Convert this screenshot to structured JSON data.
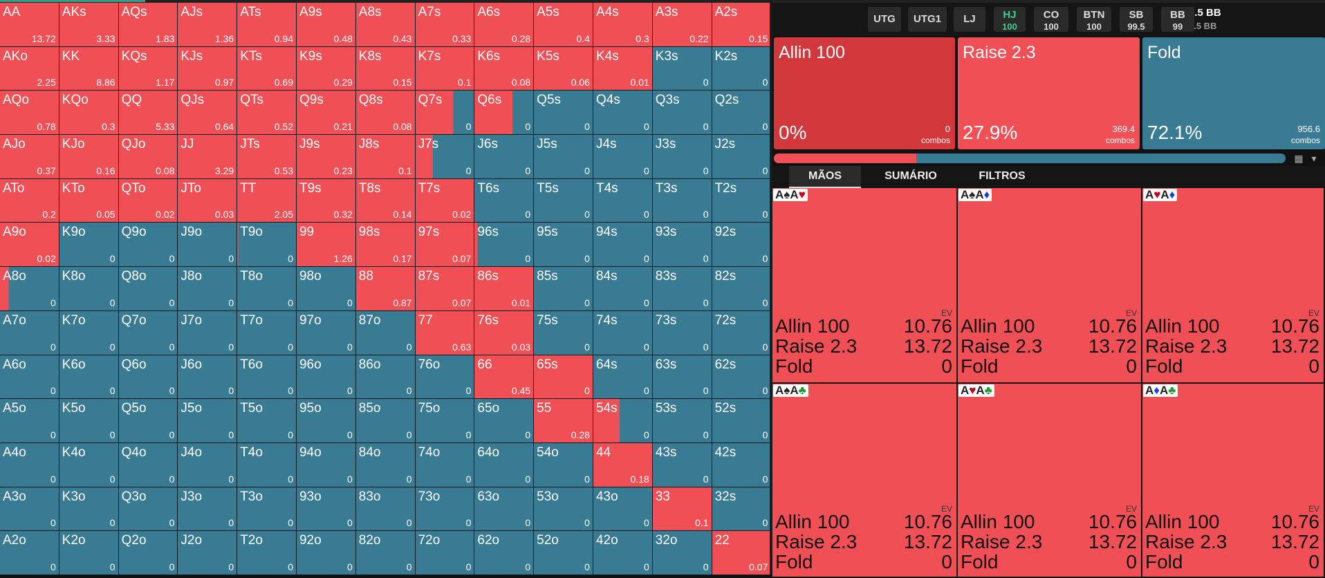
{
  "colors": {
    "raise": "#f05055",
    "fold": "#3a7b94",
    "allin": "#d2373c",
    "accent": "#3ecf8e"
  },
  "grid": [
    [
      [
        "AA",
        "13.72",
        1
      ],
      [
        "AKs",
        "3.33",
        1
      ],
      [
        "AQs",
        "1.83",
        1
      ],
      [
        "AJs",
        "1.36",
        1
      ],
      [
        "ATs",
        "0.94",
        1
      ],
      [
        "A9s",
        "0.48",
        1
      ],
      [
        "A8s",
        "0.43",
        1
      ],
      [
        "A7s",
        "0.33",
        1
      ],
      [
        "A6s",
        "0.28",
        1
      ],
      [
        "A5s",
        "0.4",
        1
      ],
      [
        "A4s",
        "0.3",
        1
      ],
      [
        "A3s",
        "0.22",
        1
      ],
      [
        "A2s",
        "0.15",
        1
      ]
    ],
    [
      [
        "AKo",
        "2.25",
        1
      ],
      [
        "KK",
        "8.86",
        1
      ],
      [
        "KQs",
        "1.17",
        1
      ],
      [
        "KJs",
        "0.97",
        1
      ],
      [
        "KTs",
        "0.69",
        1
      ],
      [
        "K9s",
        "0.29",
        1
      ],
      [
        "K8s",
        "0.15",
        1
      ],
      [
        "K7s",
        "0.1",
        1
      ],
      [
        "K6s",
        "0.08",
        1
      ],
      [
        "K5s",
        "0.06",
        1
      ],
      [
        "K4s",
        "0.01",
        1
      ],
      [
        "K3s",
        "0",
        0
      ],
      [
        "K2s",
        "0",
        0
      ]
    ],
    [
      [
        "AQo",
        "0.78",
        1
      ],
      [
        "KQo",
        "0.3",
        1
      ],
      [
        "QQ",
        "5.33",
        1
      ],
      [
        "QJs",
        "0.64",
        1
      ],
      [
        "QTs",
        "0.52",
        1
      ],
      [
        "Q9s",
        "0.21",
        1
      ],
      [
        "Q8s",
        "0.08",
        1
      ],
      [
        "Q7s",
        "0",
        0.65
      ],
      [
        "Q6s",
        "0",
        0.65
      ],
      [
        "Q5s",
        "0",
        0
      ],
      [
        "Q4s",
        "0",
        0
      ],
      [
        "Q3s",
        "0",
        0
      ],
      [
        "Q2s",
        "0",
        0
      ]
    ],
    [
      [
        "AJo",
        "0.37",
        1
      ],
      [
        "KJo",
        "0.16",
        1
      ],
      [
        "QJo",
        "0.08",
        1
      ],
      [
        "JJ",
        "3.29",
        1
      ],
      [
        "JTs",
        "0.53",
        1
      ],
      [
        "J9s",
        "0.23",
        1
      ],
      [
        "J8s",
        "0.1",
        1
      ],
      [
        "J7s",
        "0",
        0.3
      ],
      [
        "J6s",
        "0",
        0
      ],
      [
        "J5s",
        "0",
        0
      ],
      [
        "J4s",
        "0",
        0
      ],
      [
        "J3s",
        "0",
        0
      ],
      [
        "J2s",
        "0",
        0
      ]
    ],
    [
      [
        "ATo",
        "0.2",
        1
      ],
      [
        "KTo",
        "0.05",
        1
      ],
      [
        "QTo",
        "0.02",
        1
      ],
      [
        "JTo",
        "0.03",
        1
      ],
      [
        "TT",
        "2.05",
        1
      ],
      [
        "T9s",
        "0.32",
        1
      ],
      [
        "T8s",
        "0.14",
        1
      ],
      [
        "T7s",
        "0.02",
        1
      ],
      [
        "T6s",
        "0",
        0
      ],
      [
        "T5s",
        "0",
        0
      ],
      [
        "T4s",
        "0",
        0
      ],
      [
        "T3s",
        "0",
        0
      ],
      [
        "T2s",
        "0",
        0
      ]
    ],
    [
      [
        "A9o",
        "0.02",
        1
      ],
      [
        "K9o",
        "0",
        0
      ],
      [
        "Q9o",
        "0",
        0
      ],
      [
        "J9o",
        "0",
        0
      ],
      [
        "T9o",
        "0",
        0.02
      ],
      [
        "99",
        "1.26",
        1
      ],
      [
        "98s",
        "0.17",
        1
      ],
      [
        "97s",
        "0.07",
        1
      ],
      [
        "96s",
        "0",
        0.05
      ],
      [
        "95s",
        "0",
        0
      ],
      [
        "94s",
        "0",
        0
      ],
      [
        "93s",
        "0",
        0
      ],
      [
        "92s",
        "0",
        0
      ]
    ],
    [
      [
        "A8o",
        "0",
        0.15
      ],
      [
        "K8o",
        "0",
        0
      ],
      [
        "Q8o",
        "0",
        0
      ],
      [
        "J8o",
        "0",
        0
      ],
      [
        "T8o",
        "0",
        0
      ],
      [
        "98o",
        "0",
        0
      ],
      [
        "88",
        "0.87",
        1
      ],
      [
        "87s",
        "0.07",
        1
      ],
      [
        "86s",
        "0.01",
        1
      ],
      [
        "85s",
        "0",
        0
      ],
      [
        "84s",
        "0",
        0
      ],
      [
        "83s",
        "0",
        0
      ],
      [
        "82s",
        "0",
        0
      ]
    ],
    [
      [
        "A7o",
        "0",
        0
      ],
      [
        "K7o",
        "0",
        0
      ],
      [
        "Q7o",
        "0",
        0
      ],
      [
        "J7o",
        "0",
        0
      ],
      [
        "T7o",
        "0",
        0
      ],
      [
        "97o",
        "0",
        0
      ],
      [
        "87o",
        "0",
        0
      ],
      [
        "77",
        "0.63",
        1
      ],
      [
        "76s",
        "0.03",
        1
      ],
      [
        "75s",
        "0",
        0
      ],
      [
        "74s",
        "0",
        0
      ],
      [
        "73s",
        "0",
        0
      ],
      [
        "72s",
        "0",
        0
      ]
    ],
    [
      [
        "A6o",
        "0",
        0
      ],
      [
        "K6o",
        "0",
        0
      ],
      [
        "Q6o",
        "0",
        0
      ],
      [
        "J6o",
        "0",
        0
      ],
      [
        "T6o",
        "0",
        0
      ],
      [
        "96o",
        "0",
        0
      ],
      [
        "86o",
        "0",
        0
      ],
      [
        "76o",
        "0",
        0
      ],
      [
        "66",
        "0.45",
        1
      ],
      [
        "65s",
        "0",
        1
      ],
      [
        "64s",
        "0",
        0
      ],
      [
        "63s",
        "0",
        0
      ],
      [
        "62s",
        "0",
        0
      ]
    ],
    [
      [
        "A5o",
        "0",
        0
      ],
      [
        "K5o",
        "0",
        0
      ],
      [
        "Q5o",
        "0",
        0
      ],
      [
        "J5o",
        "0",
        0
      ],
      [
        "T5o",
        "0",
        0
      ],
      [
        "95o",
        "0",
        0
      ],
      [
        "85o",
        "0",
        0
      ],
      [
        "75o",
        "0",
        0
      ],
      [
        "65o",
        "0",
        0
      ],
      [
        "55",
        "0.28",
        1
      ],
      [
        "54s",
        "0",
        0.45
      ],
      [
        "53s",
        "0",
        0
      ],
      [
        "52s",
        "0",
        0
      ]
    ],
    [
      [
        "A4o",
        "0",
        0
      ],
      [
        "K4o",
        "0",
        0
      ],
      [
        "Q4o",
        "0",
        0
      ],
      [
        "J4o",
        "0",
        0
      ],
      [
        "T4o",
        "0",
        0
      ],
      [
        "94o",
        "0",
        0
      ],
      [
        "84o",
        "0",
        0
      ],
      [
        "74o",
        "0",
        0
      ],
      [
        "64o",
        "0",
        0
      ],
      [
        "54o",
        "0",
        0
      ],
      [
        "44",
        "0.18",
        1
      ],
      [
        "43s",
        "0",
        0
      ],
      [
        "42s",
        "0",
        0
      ]
    ],
    [
      [
        "A3o",
        "0",
        0
      ],
      [
        "K3o",
        "0",
        0
      ],
      [
        "Q3o",
        "0",
        0
      ],
      [
        "J3o",
        "0",
        0
      ],
      [
        "T3o",
        "0",
        0
      ],
      [
        "93o",
        "0",
        0
      ],
      [
        "83o",
        "0",
        0
      ],
      [
        "73o",
        "0",
        0
      ],
      [
        "63o",
        "0",
        0
      ],
      [
        "53o",
        "0",
        0
      ],
      [
        "43o",
        "0",
        0
      ],
      [
        "33",
        "0.1",
        1
      ],
      [
        "32s",
        "0",
        0
      ]
    ],
    [
      [
        "A2o",
        "0",
        0
      ],
      [
        "K2o",
        "0",
        0
      ],
      [
        "Q2o",
        "0",
        0
      ],
      [
        "J2o",
        "0",
        0
      ],
      [
        "T2o",
        "0",
        0
      ],
      [
        "92o",
        "0",
        0
      ],
      [
        "82o",
        "0",
        0
      ],
      [
        "72o",
        "0",
        0
      ],
      [
        "62o",
        "0",
        0
      ],
      [
        "52o",
        "0",
        0
      ],
      [
        "42o",
        "0",
        0
      ],
      [
        "32o",
        "0",
        0
      ],
      [
        "22",
        "0.07",
        1
      ]
    ]
  ],
  "positions": [
    {
      "name": "UTG",
      "stack": ""
    },
    {
      "name": "UTG1",
      "stack": ""
    },
    {
      "name": "LJ",
      "stack": ""
    },
    {
      "name": "HJ",
      "stack": "100",
      "active": true
    },
    {
      "name": "CO",
      "stack": "100"
    },
    {
      "name": "BTN",
      "stack": "100"
    },
    {
      "name": "SB",
      "stack": "99.5"
    },
    {
      "name": "BB",
      "stack": "99"
    }
  ],
  "pot": {
    "value": "2.5 BB",
    "sub": "2.5 BB"
  },
  "actions": [
    {
      "name": "Allin 100",
      "pct": "0%",
      "combos": "0",
      "combos_label": "combos",
      "color": "#d2373c"
    },
    {
      "name": "Raise 2.3",
      "pct": "27.9%",
      "combos": "369.4",
      "combos_label": "combos",
      "color": "#f05055"
    },
    {
      "name": "Fold",
      "pct": "72.1%",
      "combos": "956.6",
      "combos_label": "combos",
      "color": "#3a7b94"
    }
  ],
  "freq": {
    "raise_fraction": 0.279
  },
  "tabs": [
    "MÃOS",
    "SUMÁRIO",
    "FILTROS"
  ],
  "hands": [
    {
      "c1": "A",
      "s1": "♠",
      "s1c": "#222",
      "c2": "A",
      "s2": "♥",
      "s2c": "#c0001a"
    },
    {
      "c1": "A",
      "s1": "♠",
      "s1c": "#222",
      "c2": "A",
      "s2": "♦",
      "s2c": "#1a3fd8"
    },
    {
      "c1": "A",
      "s1": "♥",
      "s1c": "#c0001a",
      "c2": "A",
      "s2": "♦",
      "s2c": "#1a3fd8"
    },
    {
      "c1": "A",
      "s1": "♠",
      "s1c": "#222",
      "c2": "A",
      "s2": "♣",
      "s2c": "#1f9a2e"
    },
    {
      "c1": "A",
      "s1": "♥",
      "s1c": "#c0001a",
      "c2": "A",
      "s2": "♣",
      "s2c": "#1f9a2e"
    },
    {
      "c1": "A",
      "s1": "♦",
      "s1c": "#1a3fd8",
      "c2": "A",
      "s2": "♣",
      "s2c": "#1f9a2e"
    }
  ],
  "hand_ev_label": "EV",
  "hand_rows": [
    {
      "name": "Allin 100",
      "value": "10.76"
    },
    {
      "name": "Raise 2.3",
      "value": "13.72"
    },
    {
      "name": "Fold",
      "value": "0"
    }
  ]
}
